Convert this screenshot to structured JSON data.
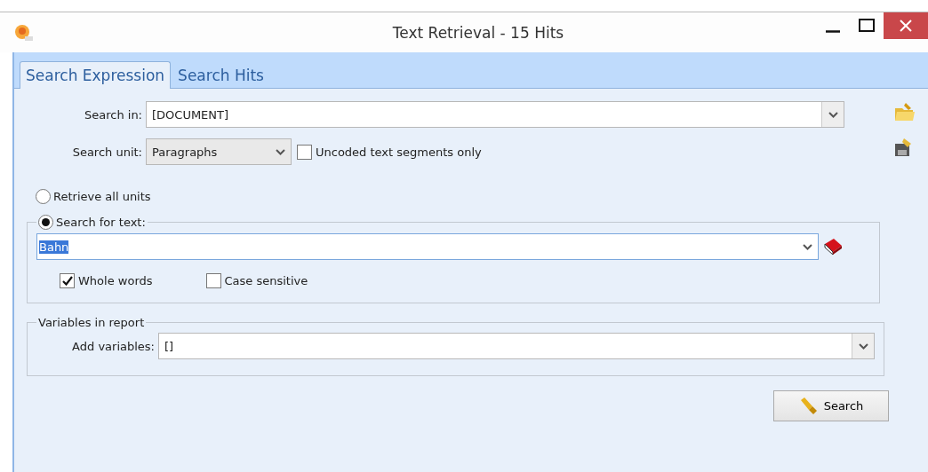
{
  "window": {
    "title": "Text Retrieval - 15 Hits"
  },
  "tabs": [
    {
      "label": "Search Expression",
      "selected": true
    },
    {
      "label": "Search Hits",
      "selected": false
    }
  ],
  "search_in": {
    "label": "Search in:",
    "value": "[DOCUMENT]"
  },
  "search_unit": {
    "label": "Search unit:",
    "value": "Paragraphs"
  },
  "uncoded_only": {
    "label": "Uncoded text segments only",
    "checked": false
  },
  "modes": [
    {
      "label": "Retrieve all units",
      "selected": false
    },
    {
      "label": "Search for text:",
      "selected": true
    }
  ],
  "search_text": {
    "value": "Bahn"
  },
  "options": [
    {
      "label": "Whole words",
      "checked": true
    },
    {
      "label": "Case sensitive",
      "checked": false
    }
  ],
  "variables": {
    "legend": "Variables in report",
    "label": "Add variables:",
    "value": "[]"
  },
  "search_button": {
    "label": "Search"
  }
}
